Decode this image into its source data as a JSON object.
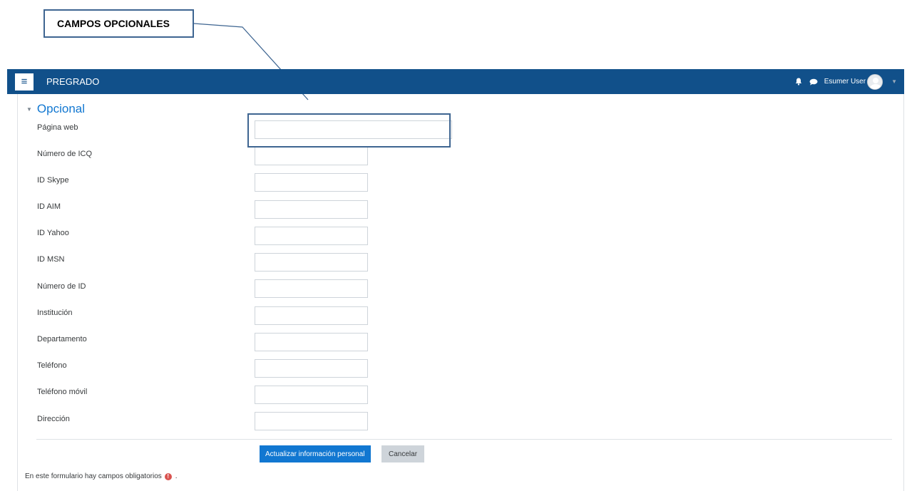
{
  "callout": {
    "label": "CAMPOS OPCIONALES"
  },
  "navbar": {
    "brand": "PREGRADO",
    "menu_icon": "hamburger-icon",
    "notification_icon": "bell-icon",
    "message_icon": "chat-icon",
    "user_name": "Esumer User",
    "avatar_icon": "user-avatar-icon",
    "bar_color": "#11508a"
  },
  "section": {
    "legend": "Opcional",
    "legend_icon": "caret-down-icon"
  },
  "fields": [
    {
      "label": "Página web",
      "value": ""
    },
    {
      "label": "Número de ICQ",
      "value": ""
    },
    {
      "label": "ID Skype",
      "value": ""
    },
    {
      "label": "ID AIM",
      "value": ""
    },
    {
      "label": "ID Yahoo",
      "value": ""
    },
    {
      "label": "ID MSN",
      "value": ""
    },
    {
      "label": "Número de ID",
      "value": ""
    },
    {
      "label": "Institución",
      "value": ""
    },
    {
      "label": "Departamento",
      "value": ""
    },
    {
      "label": "Teléfono",
      "value": ""
    },
    {
      "label": "Teléfono móvil",
      "value": ""
    },
    {
      "label": "Dirección",
      "value": ""
    }
  ],
  "actions": {
    "submit_label": "Actualizar información personal",
    "cancel_label": "Cancelar",
    "primary_color": "#1177d1"
  },
  "footer": {
    "required_note": "En este formulario hay campos obligatorios",
    "required_icon": "exclamation-circle-icon",
    "suffix": "."
  }
}
